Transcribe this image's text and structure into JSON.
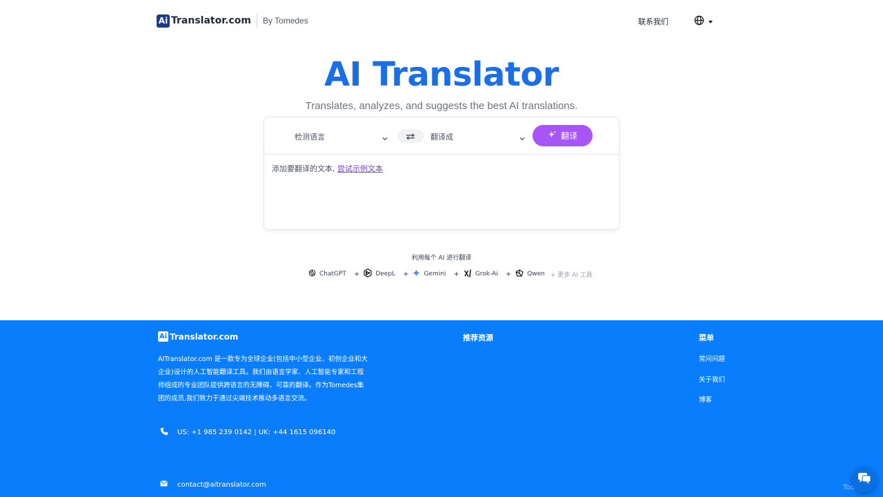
{
  "header": {
    "logo_badge": "Ai",
    "logo_text": "Translator.com",
    "by": "By Tomedes",
    "contact": "联系我们"
  },
  "hero": {
    "title": "AI Translator",
    "subtitle": "Translates, analyzes, and suggests the best AI translations."
  },
  "translator": {
    "source_lang": "检测语言",
    "target_lang": "翻译成",
    "translate_button": "翻译",
    "input_placeholder": "添加要翻译的文本,",
    "try_sample": "尝试示例文本"
  },
  "ai_strip": {
    "label": "利用每个 AI 进行翻译",
    "items": [
      "ChatGPT",
      "DeepL",
      "Gemini",
      "Grok-Ai",
      "Qwen"
    ],
    "more": "+ 更多 AI 工具"
  },
  "footer": {
    "logo_badge": "Ai",
    "logo_text": "Translator.com",
    "description": "AITranslator.com 是一款专为全球企业(包括中小型企业、初创企业和大企业)设计的人工智能翻译工具。我们由语言学家、人工智能专家和工程师组成的专业团队提供跨语言的无障碍、可靠的翻译。作为Tomedes集团的成员,我们致力于通过尖端技术推动多语言交流。",
    "phone": "US: +1 985 239 0142 | UK: +44 1615 096140",
    "email": "contact@aitranslator.com",
    "resources_heading": "推荐资源",
    "menu_heading": "菜单",
    "menu_items": [
      "常问问题",
      "关于我们",
      "博客"
    ]
  },
  "watermark": "ToolHelp",
  "colors": {
    "brand_blue": "#1a6fe6",
    "footer_blue": "#0a7dfc",
    "accent_purple": "#a855f7"
  }
}
